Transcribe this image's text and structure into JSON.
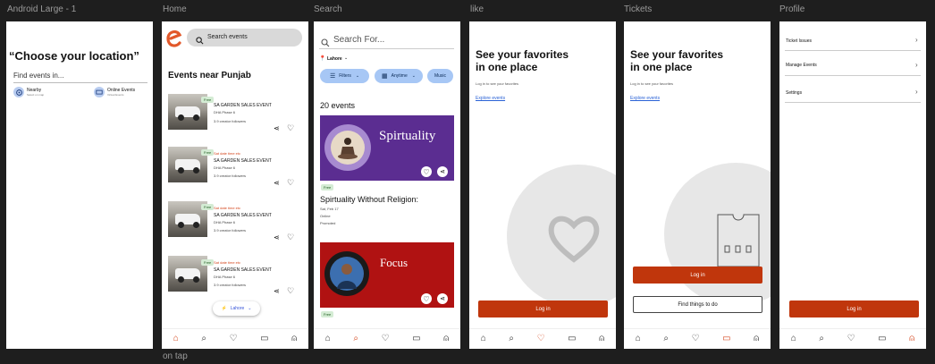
{
  "frames": {
    "android": "Android Large - 1",
    "home": "Home",
    "search": "Search",
    "like": "like",
    "tickets": "Tickets",
    "profile": "Profile"
  },
  "below_label": "on tap",
  "location": {
    "title": "“Choose your location”",
    "find_label": "Find events in...",
    "nearby_label": "Nearby",
    "nearby_sub": "Select on map",
    "online_label": "Online Events",
    "online_sub": "Virtual Events"
  },
  "home": {
    "search_placeholder": "Search events",
    "heading": "Events near Punjab",
    "events": [
      {
        "badge": "Free",
        "date": "",
        "title": "SA GARDEN SALES EVENT",
        "place": "DHA Phase 6",
        "followers": "3.9 creator followers"
      },
      {
        "badge": "Free",
        "date": "Sat date time etc",
        "title": "SA GARDEN SALES EVENT",
        "place": "DHA Phase 6",
        "followers": "3.9 creator followers"
      },
      {
        "badge": "Free",
        "date": "Sat date time etc",
        "title": "SA GARDEN SALES EVENT",
        "place": "DHA Phase 6",
        "followers": "3.9 creator followers"
      },
      {
        "badge": "Free",
        "date": "Sat date time etc",
        "title": "SA GARDEN SALES EVENT",
        "place": "DHA Phase 6",
        "followers": "3.9 creator followers"
      }
    ],
    "location_pill": "Lahore"
  },
  "search": {
    "placeholder": "Search For...",
    "location": "Lahore",
    "chip_filters": "Filters",
    "chip_anytime": "Anytime",
    "chip_music": "Music",
    "count": "20 events",
    "card1_banner": "Spirtuality",
    "card1_badge": "Free",
    "card1_title": "Spirtuality Without Religion:",
    "card1_date": "Sat, Feb 17",
    "card1_place": "Online",
    "card1_promoted": "Promoted",
    "card2_banner": "Focus",
    "card2_badge": "Free"
  },
  "like": {
    "title_line1": "See your favorites",
    "title_line2": "in one place",
    "subtitle": "Log in to see your favorites",
    "explore": "Explore events",
    "login": "Log in"
  },
  "tickets": {
    "title_line1": "See your favorites",
    "title_line2": "in one place",
    "subtitle": "Log in to see your favorites",
    "explore": "Explore events",
    "login": "Log in",
    "find": "Find things to do"
  },
  "profile": {
    "items": [
      "Ticket Issues",
      "Manage Events",
      "Settings"
    ],
    "login": "Log in"
  },
  "icons": {
    "home": "home-icon",
    "search": "search-icon",
    "heart": "heart-icon",
    "ticket": "ticket-icon",
    "profile": "profile-icon"
  },
  "colors": {
    "accent": "#c0360c",
    "chip": "#a7c7f5",
    "purple": "#5b2d91",
    "red": "#b01212",
    "background": "#1e1e1e"
  }
}
